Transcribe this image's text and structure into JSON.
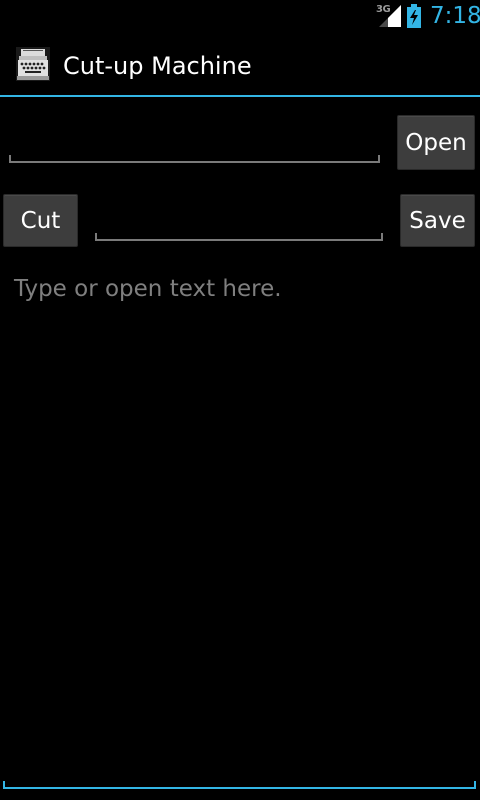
{
  "status_bar": {
    "network_label": "3G",
    "time": "7:18",
    "signal_icon": "signal-strength-icon",
    "battery_icon": "battery-charging-icon",
    "accent_color": "#33b5e5"
  },
  "action_bar": {
    "title": "Cut-up Machine",
    "app_icon": "typewriter-icon",
    "divider_color": "#33b5e5"
  },
  "row1": {
    "input_value": "",
    "open_label": "Open"
  },
  "row2": {
    "cut_label": "Cut",
    "input_value": "",
    "save_label": "Save"
  },
  "main": {
    "placeholder": "Type or open text here.",
    "value": ""
  }
}
